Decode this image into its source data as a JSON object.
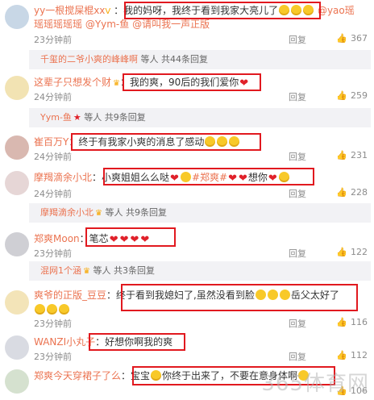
{
  "colors": {
    "accent": "#eb7350",
    "highlight": "#e1191f",
    "muted": "#8c8c8c"
  },
  "reply_label": "回复",
  "comments": [
    {
      "user": "yy一根搅屎棍xx",
      "text": "我的妈呀，我终于看到我家大亮儿了",
      "extra": "@yao瑶",
      "extra2": "瑶瑶瑶瑶瑶 @Yym-鱼 @请叫我一声正版",
      "time": "23分钟前",
      "likes": "367"
    },
    {
      "user": "这辈子只想发个财",
      "text": "我的爽，90后的我们爱你",
      "time": "24分钟前",
      "likes": "259"
    },
    {
      "user": "崔百万Y",
      "text": "终于有我家小爽的消息了感动",
      "time": "24分钟前",
      "likes": "231"
    },
    {
      "user": "摩羯滴余小北",
      "text": "小爽姐姐么么哒",
      "text2": "#郑爽#",
      "text3": "想你",
      "time": "24分钟前",
      "likes": "228"
    },
    {
      "user": "郑爽Moon",
      "text": "笔芯",
      "time": "23分钟前",
      "likes": "122"
    },
    {
      "user": "爽爷的正版_豆豆",
      "text": "终于看到我媳妇了,虽然没看到脸",
      "text2": "岳父太好了",
      "time": "23分钟前",
      "likes": "116"
    },
    {
      "user": "WANZI小丸子",
      "text": "好想你啊我的爽",
      "time": "23分钟前",
      "likes": "112"
    },
    {
      "user": "郑爽今天穿裙子了么",
      "text": "宝宝",
      "text2": "你终于出来了，不要在意身体啊",
      "likes": "106"
    }
  ],
  "subs": [
    {
      "name": "千玺的二爷小爽的峰峰啊",
      "rest": "等人 共44条回复"
    },
    {
      "name": "Yym-鱼",
      "rest": "等人 共9条回复"
    },
    {
      "name": "摩羯滴余小北",
      "rest": "等人 共9条回复"
    },
    {
      "name": "混网1个涵",
      "rest": "等人 共3条回复"
    }
  ],
  "watermark": "365体育网"
}
